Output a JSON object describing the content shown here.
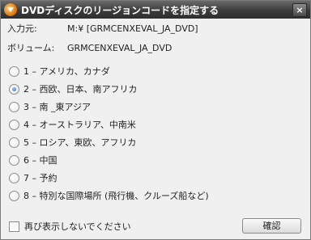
{
  "window": {
    "title": "DVDディスクのリージョンコードを指定する",
    "close_glyph": "×"
  },
  "input_source": {
    "label": "入力元:",
    "value": "M:¥ [GRMCENXEVAL_JA_DVD]"
  },
  "volume": {
    "label": "ボリューム:",
    "value": "GRMCENXEVAL_JA_DVD"
  },
  "regions": [
    {
      "label": "1 – アメリカ、カナダ",
      "checked": false
    },
    {
      "label": "2 – 西欧、日本、南アフリカ",
      "checked": true
    },
    {
      "label": "3 – 南 _東アジア",
      "checked": false
    },
    {
      "label": "4 – オーストラリア、中南米",
      "checked": false
    },
    {
      "label": "5 – ロシア、東欧、アフリカ",
      "checked": false
    },
    {
      "label": "6 – 中国",
      "checked": false
    },
    {
      "label": "7 – 予約",
      "checked": false
    },
    {
      "label": "8 – 特別な国際場所 (飛行機、クルーズ船など)",
      "checked": false
    }
  ],
  "dont_show_again": {
    "label": "再び表示しないでください",
    "checked": false
  },
  "ok_button": {
    "label": "確認"
  }
}
